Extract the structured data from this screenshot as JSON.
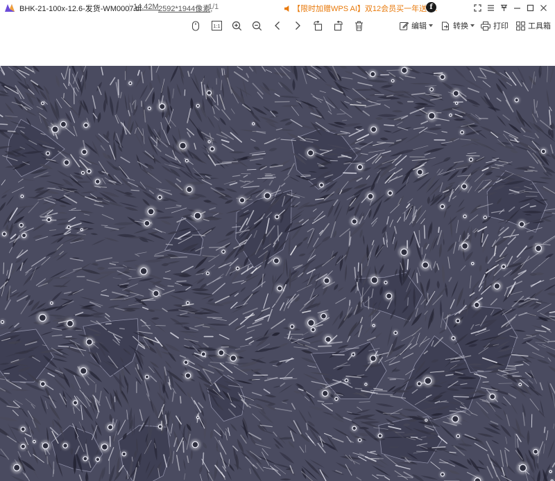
{
  "titlebar": {
    "file_name": "BHK-21-100x-12.6-发货-WM0007.tif",
    "file_size": "14.42M",
    "dimensions": "2592*1944像素",
    "page_counter": "1/1",
    "promo_text": "【限时加赠WPS AI】双12会员买一年送4...",
    "promo_color": "#e8790a",
    "ai_icon_letter": "f"
  },
  "toolbar": {
    "icons": [
      "mouse-icon",
      "actual-size-icon",
      "zoom-in-icon",
      "zoom-out-icon",
      "previous-icon",
      "next-icon",
      "rotate-left-icon",
      "rotate-right-icon",
      "delete-icon"
    ],
    "actual_size_label": "1:1",
    "edit_label": "编辑",
    "convert_label": "转换",
    "print_label": "打印",
    "toolbox_label": "工具箱"
  },
  "viewer": {
    "image_description": "phase-contrast microscopy image of adherent spindle-shaped cells",
    "background_color": "#4a4b60"
  }
}
